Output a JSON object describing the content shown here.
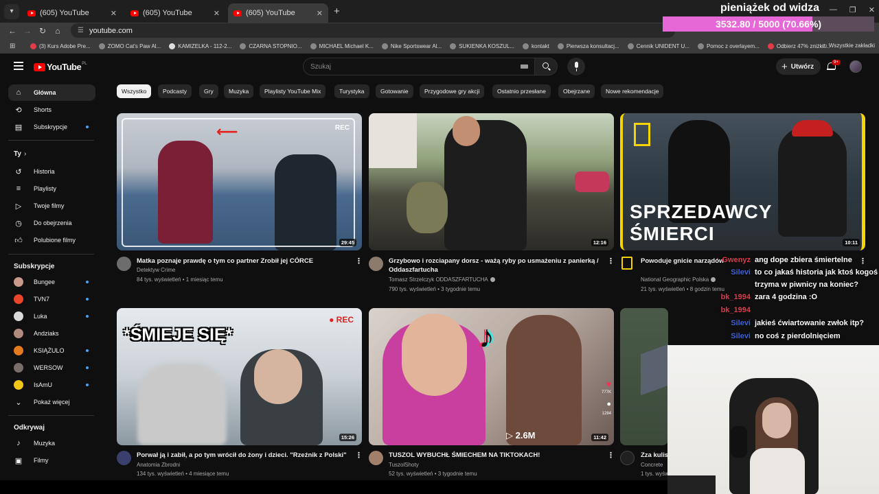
{
  "browser": {
    "tabs": [
      {
        "title": "(605) YouTube"
      },
      {
        "title": "(605) YouTube"
      },
      {
        "title": "(605) YouTube"
      }
    ],
    "url": "youtube.com",
    "bookmarks": [
      "(3) Kurs Adobe Pre...",
      "ZOMO Cat's Paw Al...",
      "KAMIZELKA - 112-2...",
      "CZARNA STOPNIO...",
      "MICHAEL Michael K...",
      "Nike Sportswear Al...",
      "SUKIENKA KOSZUL...",
      "kontakt",
      "Pierwsza konsultacj...",
      "Cennik UNIDENT U...",
      "Pomoc z overlayem...",
      "Odbierz 47% zniżki!..."
    ],
    "all_bookmarks": "Wszystkie zakładki"
  },
  "header": {
    "logo_text": "YouTube",
    "logo_country": "PL",
    "search_placeholder": "Szukaj",
    "create_label": "Utwórz",
    "notifications_badge": "9+"
  },
  "sidebar": {
    "main": [
      {
        "label": "Główna",
        "icon": "home-icon"
      },
      {
        "label": "Shorts",
        "icon": "shorts-icon"
      },
      {
        "label": "Subskrypcje",
        "icon": "subscriptions-icon"
      }
    ],
    "you_heading": "Ty",
    "you": [
      {
        "label": "Historia",
        "icon": "history-icon"
      },
      {
        "label": "Playlisty",
        "icon": "playlists-icon"
      },
      {
        "label": "Twoje filmy",
        "icon": "your-videos-icon"
      },
      {
        "label": "Do obejrzenia",
        "icon": "watch-later-icon"
      },
      {
        "label": "Polubione filmy",
        "icon": "liked-icon"
      }
    ],
    "subs_heading": "Subskrypcje",
    "subs": [
      {
        "label": "Bungee",
        "color": "#c99a8a"
      },
      {
        "label": "TVN7",
        "color": "#e8452b"
      },
      {
        "label": "Luka",
        "color": "#d9d9d9"
      },
      {
        "label": "Andziaks",
        "color": "#b08a7d"
      },
      {
        "label": "KSIĄŻULO",
        "color": "#e57a1e"
      },
      {
        "label": "WERSOW",
        "color": "#7a6d6a"
      },
      {
        "label": "IsAmU",
        "color": "#f0c419"
      }
    ],
    "show_more": "Pokaż więcej",
    "explore_heading": "Odkrywaj",
    "explore": [
      {
        "label": "Muzyka",
        "icon": "music-icon"
      },
      {
        "label": "Filmy",
        "icon": "movies-icon"
      }
    ]
  },
  "chips": [
    "Wszystko",
    "Podcasty",
    "Gry",
    "Muzyka",
    "Playlisty YouTube Mix",
    "Turystyka",
    "Gotowanie",
    "Przygodowe gry akcji",
    "Ostatnio przesłane",
    "Obejrzane",
    "Nowe rekomendacje"
  ],
  "videos": [
    {
      "title": "Matka poznaje prawdę o tym co partner Zrobił jej CÓRCE",
      "channel": "Detektyw Crime",
      "meta": "84 tys. wyświetleń • 1 miesiąc temu",
      "duration": "29:45",
      "overlay": "REC",
      "verified": false
    },
    {
      "title": "Grzybowo i rozciapany dorsz - ważą ryby po usmażeniu z panierką / Oddaszfartucha",
      "channel": "Tomasz Strzelczyk ODDASZFARTUCHA",
      "meta": "790 tys. wyświetleń • 3 tygodnie temu",
      "duration": "12:16",
      "overlay": "",
      "verified": true
    },
    {
      "title": "Powoduje gnicie narządów",
      "channel": "National Geographic Polska",
      "meta": "21 tys. wyświetleń • 8 godzin temu",
      "duration": "10:11",
      "overlay": "SPRZEDAWCY ŚMIERCI",
      "verified": true
    },
    {
      "title": "Porwał ją i zabił, a po tym wrócił do żony i dzieci. \"Rzeźnik z Polski\"",
      "channel": "Anatomia Zbrodni",
      "meta": "134 tys. wyświetleń • 4 miesiące temu",
      "duration": "15:26",
      "overlay": "*ŚMIEJE SIĘ*",
      "overlay2": "REC",
      "verified": false
    },
    {
      "title": "TUSZOL WYBUCHŁ ŚMIECHEM NA TIKTOKACH!",
      "channel": "TuszolShoty",
      "meta": "52 tys. wyświetleń • 3 tygodnie temu",
      "duration": "11:42",
      "overlay": "2.6M",
      "overlay2": "777K",
      "overlay3": "1284",
      "verified": false
    },
    {
      "title": "Zza kulis",
      "channel": "Concrete",
      "meta": "1 tys. wyświe",
      "duration": "",
      "overlay": "",
      "verified": false
    }
  ],
  "stream": {
    "donation_label": "pieniążek od widza",
    "donation_text": "3532.80 / 5000 (70.66%)",
    "donation_progress": 0.7066,
    "chat": [
      {
        "user": "Gwenyz",
        "text": "ang dope zbiera śmiertelne",
        "color": "red"
      },
      {
        "user": "Silevi",
        "text": "to co jakaś historia jak ktoś kogoś",
        "color": "blue"
      },
      {
        "user": "",
        "text": "trzyma w piwnicy na koniec?",
        "color": "red"
      },
      {
        "user": "bk_1994",
        "text": "zara 4 godzina :O",
        "color": "red"
      },
      {
        "user": "bk_1994",
        "text": "",
        "color": "red"
      },
      {
        "user": "Silevi",
        "text": "jakieś ćwiartowanie zwłok itp?",
        "color": "blue"
      },
      {
        "user": "Silevi",
        "text": "no coś z pierdolnięciem",
        "color": "blue"
      }
    ]
  }
}
